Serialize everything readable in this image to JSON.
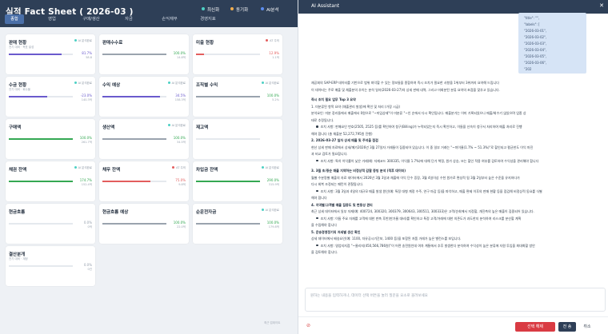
{
  "page": {
    "title": "실적 Fact Sheet ( 2026-03 )",
    "legend": [
      {
        "label": "최신화",
        "color": "#4dd0c4"
      },
      {
        "label": "동기화",
        "color": "#f0ad4e"
      },
      {
        "label": "AI분석",
        "color": "#5b8def"
      }
    ],
    "tabs": [
      "종합",
      "영업",
      "구매/생산",
      "자금",
      "손익재무",
      "경영지표"
    ],
    "active_tab": 0,
    "footnote": "최근 업데이트"
  },
  "cards": [
    {
      "name": "판매 현황",
      "sub": "전기 대비 · 목표 달성",
      "status": "AI 분석완료",
      "status_color": "#4dd0c4",
      "pct": "81.7%",
      "val": "58.8",
      "fill": 0.82,
      "bar_color": "#6a5acd",
      "pct_color": "#6a5acd"
    },
    {
      "name": "판매수수료",
      "sub": "",
      "status": "",
      "status_color": "#4dd0c4",
      "pct": "100.0%",
      "val": "14.8억",
      "fill": 1.0,
      "bar_color": "#9aa3ae",
      "pct_color": "#34a853"
    },
    {
      "name": "미출 현황",
      "sub": "",
      "status": "AT 주의",
      "status_color": "#e35d5d",
      "pct": "12.9%",
      "val": "1.1억",
      "fill": 0.13,
      "bar_color": "#e35d5d",
      "pct_color": "#e35d5d"
    },
    {
      "name": "수금 현황",
      "sub": "전기 대비 · 회수율",
      "status": "AI 분석완료",
      "status_color": "#4dd0c4",
      "pct": "-23.0%",
      "val": "140.3억",
      "fill": 0.6,
      "bar_color": "#6a5acd",
      "pct_color": "#6a5acd"
    },
    {
      "name": "수익 예상",
      "sub": "",
      "status": "AI 분석완료",
      "status_color": "#4dd0c4",
      "pct": "34.5%",
      "val": "158.3억",
      "fill": 0.9,
      "bar_color": "#6a5acd",
      "pct_color": "#6a5acd"
    },
    {
      "name": "조직별 수익",
      "sub": "",
      "status": "AI 분석완료",
      "status_color": "#4dd0c4",
      "pct": "100.0%",
      "val": "5.2%",
      "fill": 1.0,
      "bar_color": "#9aa3ae",
      "pct_color": "#34a853"
    },
    {
      "name": "구매액",
      "sub": "",
      "status": "",
      "status_color": "#4dd0c4",
      "pct": "100.0%",
      "val": "261.7억",
      "fill": 1.0,
      "bar_color": "#34a853",
      "pct_color": "#34a853"
    },
    {
      "name": "생산액",
      "sub": "",
      "status": "AI 분석완료",
      "status_color": "#4dd0c4",
      "pct": "100.0%",
      "val": "34.5억",
      "fill": 1.0,
      "bar_color": "#9aa3ae",
      "pct_color": "#34a853"
    },
    {
      "name": "재고액",
      "sub": "",
      "status": "",
      "status_color": "#4dd0c4",
      "pct": "",
      "val": "",
      "fill": 0,
      "bar_color": "#9aa3ae",
      "pct_color": "#97a1ae"
    },
    {
      "name": "채권 잔액",
      "sub": "",
      "status": "AI 분석완료",
      "status_color": "#4dd0c4",
      "pct": "174.7%",
      "val": "152.4억",
      "fill": 1.0,
      "bar_color": "#34a853",
      "pct_color": "#34a853"
    },
    {
      "name": "채무 잔액",
      "sub": "",
      "status": "AT 주의",
      "status_color": "#e35d5d",
      "pct": "75.0%",
      "val": "9.8억",
      "fill": 0.75,
      "bar_color": "#e35d5d",
      "pct_color": "#e35d5d"
    },
    {
      "name": "차입금 잔액",
      "sub": "",
      "status": "AI 분석완료",
      "status_color": "#4dd0c4",
      "pct": "290.0%",
      "val": "315.9억",
      "fill": 1.0,
      "bar_color": "#34a853",
      "pct_color": "#34a853"
    },
    {
      "name": "현금흐름",
      "sub": "",
      "status": "",
      "status_color": "#4dd0c4",
      "pct": "0.0%",
      "val": "0억",
      "fill": 0,
      "bar_color": "#9aa3ae",
      "pct_color": "#97a1ae"
    },
    {
      "name": "현금흐름 예상",
      "sub": "",
      "status": "",
      "status_color": "#4dd0c4",
      "pct": "100.0%",
      "val": "22.0억",
      "fill": 1.0,
      "bar_color": "#9aa3ae",
      "pct_color": "#34a853"
    },
    {
      "name": "순운전자금",
      "sub": "",
      "status": "AI 분석완료",
      "status_color": "#4dd0c4",
      "pct": "100.0%",
      "val": "179.8억",
      "fill": 1.0,
      "bar_color": "#9aa3ae",
      "pct_color": "#34a853"
    },
    {
      "name": "결산분개",
      "sub": "전기 대비 · 계정",
      "status": "",
      "status_color": "#4dd0c4",
      "pct": "0.0%",
      "val": "0건",
      "fill": 0,
      "bar_color": "#9aa3ae",
      "pct_color": "#97a1ae"
    }
  ],
  "assistant": {
    "title": "AI Assistant",
    "close": "✕",
    "bubble_lines": [
      "\"title\": \"\",",
      "\"labels\": [",
      "\"2026-03-01\",",
      "\"2026-03-02\",",
      "\"2026-03-03\",",
      "\"2026-03-04\",",
      "\"2026-03-05\",",
      "\"2026-03-06\",",
      "\"202"
    ],
    "messages": [
      {
        "text": "재공회의 SAP-ERP 데이터를 기반으로 범위 파악할 수 있는 정보들을 종합하여 즉시 조치가 필요한 사항을 1위부터 3위까지 요약해 드립니다",
        "bold": false,
        "bullet": false
      },
      {
        "text": "이 데이터는 주로 매출 및 채출분의 추이는 분석 일자(2026-03-27)의 상세 판매 내역, 그리고 미회분된 분류 요약의 초점을 맞추고 있습니다.",
        "bold": false,
        "bullet": false
      },
      {
        "text": "",
        "bold": false,
        "bullet": false
      },
      {
        "text": "즉시 조치 필요 업무 Top 3 요약",
        "bold": true,
        "bullet": false
      },
      {
        "text": "1. 미분류된 항목 요약 (채출관리 발생)에 확인 및 처리 (가장 시급)",
        "bold": false,
        "bullet": false
      },
      {
        "text": "분석요인: 미분 장리들에서 매출에서 0원으로 \"~미입상태\"이 미분류 \"~인 순에서 다시 확인됩니다. 매출분가는 이미 기록되었으나 매출/회수기 않았으며 업종 상",
        "bold": false,
        "bullet": false
      },
      {
        "text": "태로 추정됩니다.",
        "bold": false,
        "bullet": false
      },
      {
        "text": "조치 사항: 판매요인 번호(2505, 2525 등)를 확인하여 청구(Billing)가 누락되었는지 즉시 확인하고, 이들을 신속이 청구서 처리하여 매출 처리로 진행",
        "bold": false,
        "bullet": true
      },
      {
        "text": "해야 합니다 (총 채출분 52,272,795원 진행)",
        "bold": false,
        "bullet": false
      },
      {
        "text": "2. 2026-03-27 일자 상세 매출 및 주석을 점검",
        "bold": true,
        "bullet": false
      },
      {
        "text": "현산 상세 판매 자료에서 상세/메가2026년 3월 27일자 거래들이 집중되어 있습니다. 이 중 일부 거래는 \"~미이율(1.7% ~ 51.3%)\"로 할인되고 평균한도 이익 마진",
        "bold": false,
        "bullet": false
      },
      {
        "text": "과 비교 검토가 필요합니다.",
        "bold": false,
        "bullet": false
      },
      {
        "text": "조치 사항: 특히 이익률이 낮은 거래(예: 자재코드 300335, 이익율 1.7%)에 대해 단가 책정, 원가 상승, 또는 할인 적용 여부를 검토하여 수익성을 관리해야 합니다",
        "bold": false,
        "bullet": true
      },
      {
        "text": "",
        "bold": false,
        "bullet": false
      },
      {
        "text": "3. 3월 초/중순 매출 지역하는 비정상적 감찰 증빙 분석 (적후 데이터)",
        "bold": true,
        "bullet": false
      },
      {
        "text": "월별 수분량별 매출의 자료 데이터에서 2026년 3월 3일과 채출에 이익 단수 증장, 3월 4일이상 수천 원가로 편성적 됨 3월 2일부터 높은 수준을 유지하다가",
        "bold": false,
        "bullet": false
      },
      {
        "text": "다시 회복 조정되는 패턴이 관찰됩니다.",
        "bold": false,
        "bullet": false
      },
      {
        "text": "조치 사항: 3월 3일과 4일의 대규모 매출 발생 원인(예: 특정 대형 계정 수주, 연구 마감 등)을 파악하고, 매출 편제 이후의 판매 현황 등을 점검해 비정상적 동요를 식별",
        "bold": false,
        "bullet": true
      },
      {
        "text": "해야 합니다",
        "bold": false,
        "bullet": false
      },
      {
        "text": "4. 지역별/고객별 매출 집중도 및 변동성 관리",
        "bold": true,
        "bullet": false
      },
      {
        "text": "최근 상세 데이터에서 일부 자재(예: 400724, 300320, 300379, 300643, 300511, 300333)은 고객/순회에서 지정할, 개진측의 높은 매출이 집중되어 있습니다.",
        "bold": false,
        "bullet": false
      },
      {
        "text": "조치 사항: 이들 주요 자재를 고객에 대한 판촉 후반(판가율 대비)를 확인하고 특정 고객/거래에 대한 의존도가 과도한지 분석하여 리스크를 분산할 계획",
        "bold": false,
        "bullet": true
      },
      {
        "text": "을 수립해야 합니다",
        "bold": false,
        "bullet": false
      },
      {
        "text": "5. 운송경영정기의 저세별 생산 확인",
        "bold": true,
        "bullet": false
      },
      {
        "text": "상세 데이터에서 배송요인(예: 1100, 자유공시기간보, 1400 등)을 포함된 저품 거래가 높은 밸런스를 보입니다.",
        "bold": false,
        "bullet": false
      },
      {
        "text": "조치 사항: 영업지지점 \"~물리지(450,566,786원)\"이 어떤 송전원인데 여차 계통에서 추후 발생한다 분석하여 수익성이 높은 분류에 자원 투입을 최대화할 방안",
        "bold": false,
        "bullet": true
      },
      {
        "text": "을 검토해야 합니다.",
        "bold": false,
        "bullet": false
      }
    ],
    "input_placeholder": "원하는 내용을 입력하거나, 데이터 선택 버튼을 눌러 질문을 요소로 올려보세요",
    "attach_icon": "⊘",
    "btn_red": "선택 해제",
    "btn_dark": "전 송",
    "btn_plain": "취소"
  }
}
